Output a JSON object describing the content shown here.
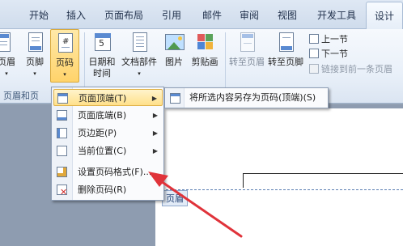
{
  "tabs": [
    {
      "label": "开始"
    },
    {
      "label": "插入"
    },
    {
      "label": "页面布局"
    },
    {
      "label": "引用"
    },
    {
      "label": "邮件"
    },
    {
      "label": "审阅"
    },
    {
      "label": "视图"
    },
    {
      "label": "开发工具"
    },
    {
      "label": "设计"
    }
  ],
  "ribbon": {
    "header_partial_label": "页眉",
    "footer_label": "页脚",
    "page_number_label": "页码",
    "group_label": "页眉和页",
    "datetime_label_1": "日期和",
    "datetime_label_2": "时间",
    "docparts_label": "文档部件",
    "picture_label": "图片",
    "clipart_label": "剪贴画",
    "goto_header_label": "转至页眉",
    "goto_footer_label": "转至页脚",
    "prev_section_label": "上一节",
    "next_section_label": "下一节",
    "link_prev_label": "链接到前一条页眉"
  },
  "menu": {
    "items": [
      {
        "label": "页面顶端(T)"
      },
      {
        "label": "页面底端(B)"
      },
      {
        "label": "页边距(P)"
      },
      {
        "label": "当前位置(C)"
      },
      {
        "label": "设置页码格式(F)..."
      },
      {
        "label": "删除页码(R)"
      }
    ]
  },
  "submenu": {
    "label": "将所选内容另存为页码(顶端)(S)"
  },
  "document": {
    "header_tag": "页眉"
  },
  "colors": {
    "accent_highlight": "#ffe08a",
    "arrow_red": "#e0333a"
  }
}
